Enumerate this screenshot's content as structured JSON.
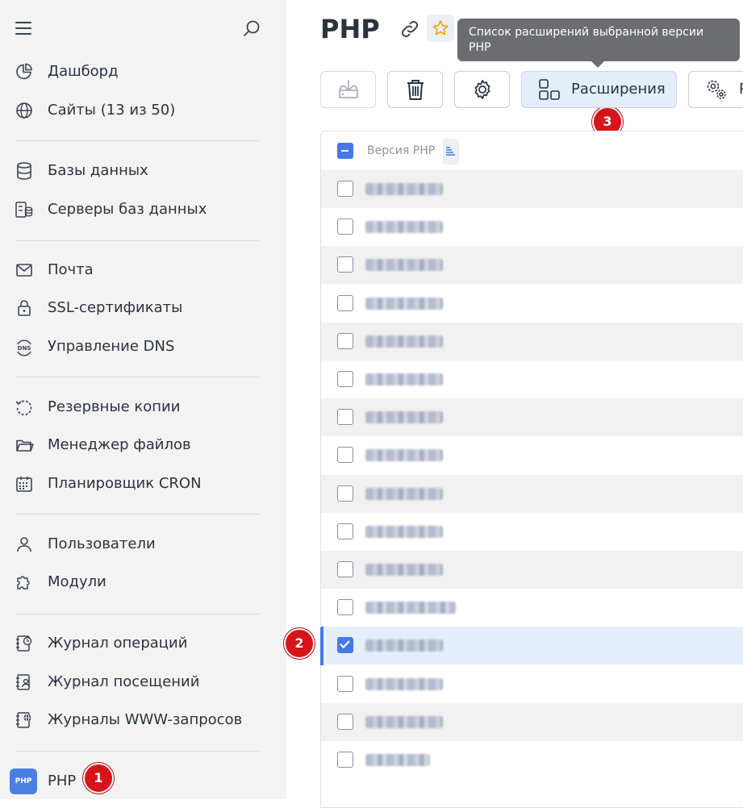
{
  "sidebar": {
    "groups": [
      {
        "items": [
          {
            "icon": "dashboard-icon",
            "label": "Дашборд"
          },
          {
            "icon": "globe-icon",
            "label": "Сайты (13 из 50)"
          }
        ]
      },
      {
        "items": [
          {
            "icon": "database-icon",
            "label": "Базы данных"
          },
          {
            "icon": "database-server-icon",
            "label": "Серверы баз данных"
          }
        ]
      },
      {
        "items": [
          {
            "icon": "mail-icon",
            "label": "Почта"
          },
          {
            "icon": "lock-icon",
            "label": "SSL-сертификаты"
          },
          {
            "icon": "dns-icon",
            "label": "Управление DNS"
          }
        ]
      },
      {
        "items": [
          {
            "icon": "backup-icon",
            "label": "Резервные копии"
          },
          {
            "icon": "folder-icon",
            "label": "Менеджер файлов"
          },
          {
            "icon": "calendar-icon",
            "label": "Планировщик CRON"
          }
        ]
      },
      {
        "items": [
          {
            "icon": "user-icon",
            "label": "Пользователи"
          },
          {
            "icon": "puzzle-icon",
            "label": "Модули"
          }
        ]
      },
      {
        "items": [
          {
            "icon": "operations-log-icon",
            "label": "Журнал операций"
          },
          {
            "icon": "visits-log-icon",
            "label": "Журнал посещений"
          },
          {
            "icon": "www-log-icon",
            "label": "Журналы WWW-запросов"
          }
        ]
      }
    ],
    "php_item": {
      "logo": "PHP",
      "label": "PHP"
    }
  },
  "badges": {
    "b1": "1",
    "b2": "2",
    "b3": "3"
  },
  "header": {
    "title": "PHP"
  },
  "tooltip": {
    "text": "Список расширений выбранной версии PHP"
  },
  "toolbar": {
    "extensions_label": "Расширения",
    "last_label": "Р"
  },
  "table": {
    "column_header": "Версия PHP",
    "rows": [
      {
        "checked": false
      },
      {
        "checked": false
      },
      {
        "checked": false
      },
      {
        "checked": false
      },
      {
        "checked": false
      },
      {
        "checked": false
      },
      {
        "checked": false
      },
      {
        "checked": false
      },
      {
        "checked": false
      },
      {
        "checked": false
      },
      {
        "checked": false
      },
      {
        "checked": false
      },
      {
        "checked": true
      },
      {
        "checked": false
      },
      {
        "checked": false
      },
      {
        "checked": false
      }
    ]
  },
  "colors": {
    "accent": "#4678e8",
    "badge": "#d8141b",
    "sidebar_bg": "#f3f3f3",
    "tooltip_bg": "#6b6d70"
  }
}
